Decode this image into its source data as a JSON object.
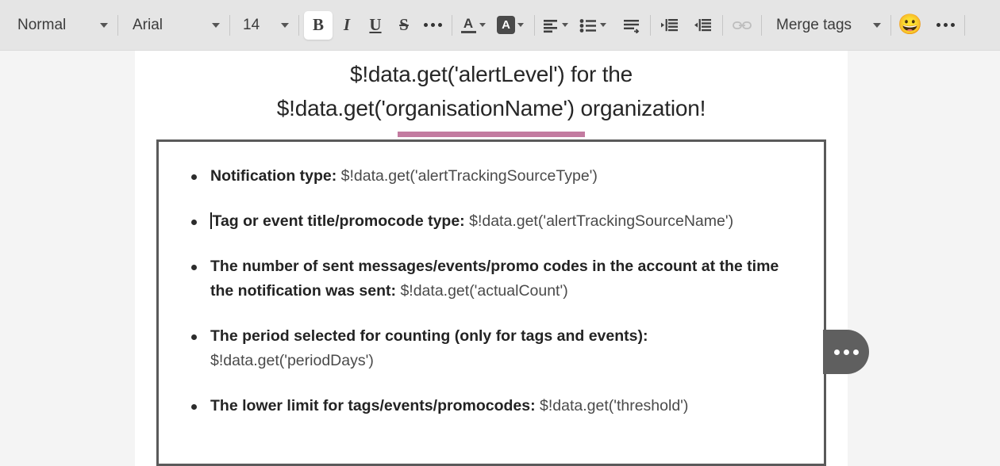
{
  "toolbar": {
    "paragraph_style": {
      "label": "Normal",
      "icon": "chevron-down-icon"
    },
    "font_family": {
      "label": "Arial",
      "icon": "chevron-down-icon"
    },
    "font_size": {
      "label": "14",
      "icon": "chevron-down-icon"
    },
    "bold": {
      "label": "B",
      "icon": "bold-icon",
      "active": true
    },
    "italic": {
      "label": "I",
      "icon": "italic-icon"
    },
    "underline": {
      "label": "U",
      "icon": "underline-icon"
    },
    "strikethrough": {
      "label": "S",
      "icon": "strikethrough-icon"
    },
    "more_text_format": {
      "icon": "ellipsis-icon"
    },
    "text_color": {
      "label": "A",
      "icon": "text-color-icon"
    },
    "highlight_color": {
      "label": "A",
      "icon": "highlight-color-icon"
    },
    "align": {
      "icon": "align-left-icon"
    },
    "bullet_list": {
      "icon": "bulleted-list-icon"
    },
    "line_height": {
      "icon": "line-height-icon"
    },
    "indent_decrease": {
      "icon": "indent-decrease-icon"
    },
    "indent_increase": {
      "icon": "indent-increase-icon"
    },
    "link": {
      "icon": "link-icon",
      "disabled": true
    },
    "merge_tags": {
      "label": "Merge tags",
      "icon": "chevron-down-icon"
    },
    "emoji": {
      "glyph": "😀",
      "icon": "emoji-icon"
    },
    "more_options": {
      "icon": "ellipsis-icon"
    }
  },
  "document": {
    "heading_line1": "$!data.get('alertLevel') for the",
    "heading_line2": "$!data.get('organisationName') organization!",
    "accent_color": "#c37ba0",
    "bullets": [
      {
        "label": "Notification type:",
        "value": " $!data.get('alertTrackingSourceType')",
        "caret_before_label": false
      },
      {
        "label": "Tag or event title/promocode type:",
        "value": " $!data.get('alertTrackingSourceName')",
        "caret_before_label": true
      },
      {
        "label": "The number of sent messages/events/promo codes in the account at the time the notification was sent:",
        "value": " $!data.get('actualCount')",
        "caret_before_label": false
      },
      {
        "label": "The period selected for counting (only for tags and events):",
        "value": " $!data.get('periodDays')",
        "caret_before_label": false
      },
      {
        "label": "The lower limit for tags/events/promocodes:",
        "value": " $!data.get('threshold')",
        "caret_before_label": false
      }
    ]
  },
  "side_tab": {
    "icon": "ellipsis-icon"
  }
}
